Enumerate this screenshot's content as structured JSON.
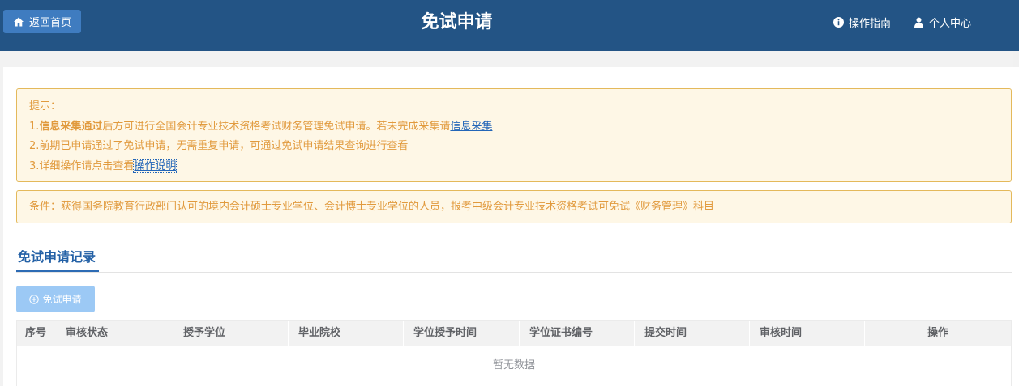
{
  "header": {
    "home_label": "返回首页",
    "title": "免试申请",
    "guide_label": "操作指南",
    "personal_label": "个人中心"
  },
  "tips": {
    "heading": "提示：",
    "line1_num": "1.",
    "line1_bold": "信息采集通过",
    "line1_text": "后方可进行全国会计专业技术资格考试财务管理免试申请。若未完成采集请",
    "line1_link": "信息采集",
    "line2": "2.前期已申请通过了免试申请，无需重复申请，可通过免试申请结果查询进行查看",
    "line3_text": "3.详细操作请点击查看",
    "line3_link": "操作说明"
  },
  "condition": "条件：获得国务院教育行政部门认可的境内会计硕士专业学位、会计博士专业学位的人员，报考中级会计专业技术资格考试可免试《财务管理》科目",
  "records": {
    "tab_title": "免试申请记录",
    "apply_button": "免试申请",
    "columns": [
      "序号",
      "审核状态",
      "授予学位",
      "毕业院校",
      "学位授予时间",
      "学位证书编号",
      "提交时间",
      "审核时间",
      "操作"
    ],
    "empty_text": "暂无数据"
  },
  "icons": {
    "home": "home-icon",
    "guide": "info-circle-icon",
    "personal": "user-icon",
    "apply": "plus-circle-icon"
  },
  "colors": {
    "header_bg": "#235485",
    "home_button": "#3f7cc0",
    "tip_text": "#e19a3d",
    "tip_bg": "#fef7e6",
    "tip_border": "#e4b95b",
    "link": "#2366b8",
    "tab_accent": "#2461a6",
    "apply_button": "#9cc9f5"
  }
}
